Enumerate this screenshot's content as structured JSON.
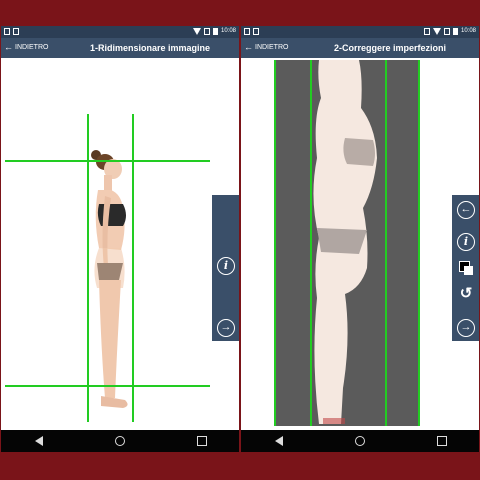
{
  "left_screen": {
    "status": {
      "time": "10:08"
    },
    "back_label": "INDIETRO",
    "title": "1-Ridimensionare immagine"
  },
  "right_screen": {
    "status": {
      "time": "10:08"
    },
    "back_label": "INDIETRO",
    "title": "2-Correggere imperfezioni"
  },
  "icons": {
    "back_arrow": "arrow-left-icon",
    "info": "info-icon",
    "next": "arrow-right-icon",
    "prev": "arrow-left-circle-icon",
    "color": "color-swap-icon",
    "undo": "undo-history-icon"
  },
  "colors": {
    "frame": "#7a1419",
    "appbar": "#3a4f69",
    "guide_line": "#22cc22",
    "overlay": "#555555"
  }
}
